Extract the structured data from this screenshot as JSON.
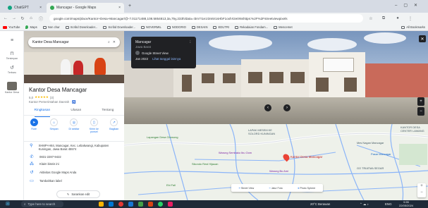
{
  "browser": {
    "tabs": [
      {
        "label": "ChatGPT",
        "color": "#10a37f"
      },
      {
        "label": "Mancagar - Google Maps",
        "color": "#34a853"
      }
    ],
    "new_tab": "+",
    "url": "google.com/maps/place/Kantor+Desa+Mancagar/@-7.01171488,108.5854813,3a,75y,233h/data=!3m7!1e1!3m5!1sHbF1oxh!!2e0!6shttps:%2F%2Fstreetviewpixels",
    "bookmarks": [
      "YouTube",
      "Maps",
      "Non char",
      "Scribd Downloader...",
      "Scribd Downloader...",
      "NOVERMIL",
      "NODORIO",
      "DESAIN",
      "EDUTRI",
      "Rekadaian Fondam...",
      "Mencemet"
    ],
    "all_bookmarks": "All Bookmarks"
  },
  "rail": {
    "items": [
      {
        "label": "Tersimpan",
        "icon": "bookmark-icon"
      },
      {
        "label": "Terbaru",
        "icon": "history-icon"
      },
      {
        "label": "Kantor Desa",
        "icon": "place-thumb-icon"
      }
    ]
  },
  "panel": {
    "search_value": "Kantor Desa Mancagar",
    "title": "Kantor Desa Mancagar",
    "rating": "5,0",
    "stars": "★★★★★",
    "review_count": "(3)",
    "category": "Kantor Pemerintahan Daerah · ♿",
    "tabs": [
      "Ringkasan",
      "Ulasan",
      "Tentang"
    ],
    "actions": [
      {
        "label": "Rute",
        "glyph": "➤"
      },
      {
        "label": "Simpan",
        "glyph": "⌂"
      },
      {
        "label": "Di sekitar",
        "glyph": "◎"
      },
      {
        "label": "Kirim ke ponsel",
        "glyph": "▯"
      },
      {
        "label": "Bagikan",
        "glyph": "↗"
      }
    ],
    "info": [
      {
        "icon": "location-pin-icon",
        "glyph": "⚲",
        "text": "XHMP+H84, Mancagar, Kec. Lebakwangi, Kabupaten Kuningan, Jawa Barat 45574"
      },
      {
        "icon": "phone-icon",
        "glyph": "✆",
        "text": "0831-2287-9422"
      },
      {
        "icon": "plus-code-icon",
        "glyph": "⁂",
        "text": "Klaim bisnis ini"
      },
      {
        "icon": "history-icon",
        "glyph": "↺",
        "text": "Aktivitas Google Maps Anda"
      },
      {
        "icon": "label-icon",
        "glyph": "▭",
        "text": "Tambahkan label"
      }
    ],
    "suggest_edit": "Sarankan edit"
  },
  "streetview": {
    "place": "Mancagar",
    "sub": "Jawa Barat",
    "photographer": "Google Street View",
    "date_label": "Jan 2022",
    "more_dates": "Lihat tanggal lainnya"
  },
  "map": {
    "labels": [
      {
        "text": "Lapangan Desa Cilowong",
        "color": "#2e7d32"
      },
      {
        "text": "LAPAK MESEM KE SOLORD KUNINGAN",
        "color": "#455a64"
      },
      {
        "text": "Warung Sembako Ibu Oom",
        "color": "#7b1fa2"
      },
      {
        "text": "Kantor Desa Mancagar",
        "color": "#c5221f"
      },
      {
        "text": "Pasar Mancagar",
        "color": "#1565c0"
      },
      {
        "text": "GO TRIATMA SEGAR",
        "color": "#455a64"
      },
      {
        "text": "Mes Nagan Mancagar",
        "color": "#455a64"
      },
      {
        "text": "KANTOR DESA CENTER LAWANG",
        "color": "#455a64"
      },
      {
        "text": "Sikondo Rest Hijauan",
        "color": "#2e7d32"
      },
      {
        "text": "Warung Bu Ami",
        "color": "#7b1fa2"
      },
      {
        "text": "Ebi Fall",
        "color": "#2e7d32"
      }
    ],
    "layers": [
      "Street View",
      "Jalur Foto",
      "Photo Sphere"
    ]
  },
  "taskbar": {
    "search_placeholder": "Type here to search",
    "weather": "20°C  Berawan",
    "lang": "ENG",
    "time": "9:55",
    "date": "22/05/2024"
  }
}
